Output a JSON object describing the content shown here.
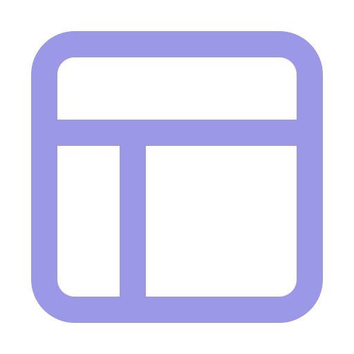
{
  "icon": {
    "name": "layout-sidebar-icon",
    "color": "#9b98e8"
  }
}
